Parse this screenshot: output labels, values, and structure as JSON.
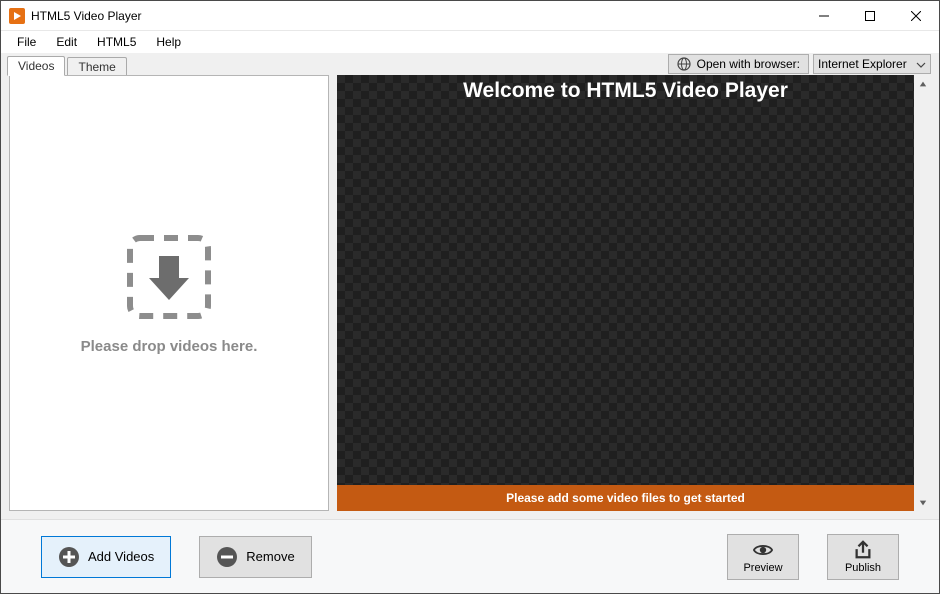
{
  "window": {
    "title": "HTML5 Video Player"
  },
  "menu": {
    "items": [
      "File",
      "Edit",
      "HTML5",
      "Help"
    ]
  },
  "tabs": {
    "items": [
      "Videos",
      "Theme"
    ],
    "active": 0
  },
  "browserBar": {
    "label": "Open with browser:",
    "selected": "Internet Explorer"
  },
  "dropzone": {
    "text": "Please drop videos here."
  },
  "preview": {
    "title": "Welcome to HTML5 Video Player",
    "footer": "Please add some video files to get started"
  },
  "buttons": {
    "addVideos": "Add Videos",
    "remove": "Remove",
    "preview": "Preview",
    "publish": "Publish"
  }
}
